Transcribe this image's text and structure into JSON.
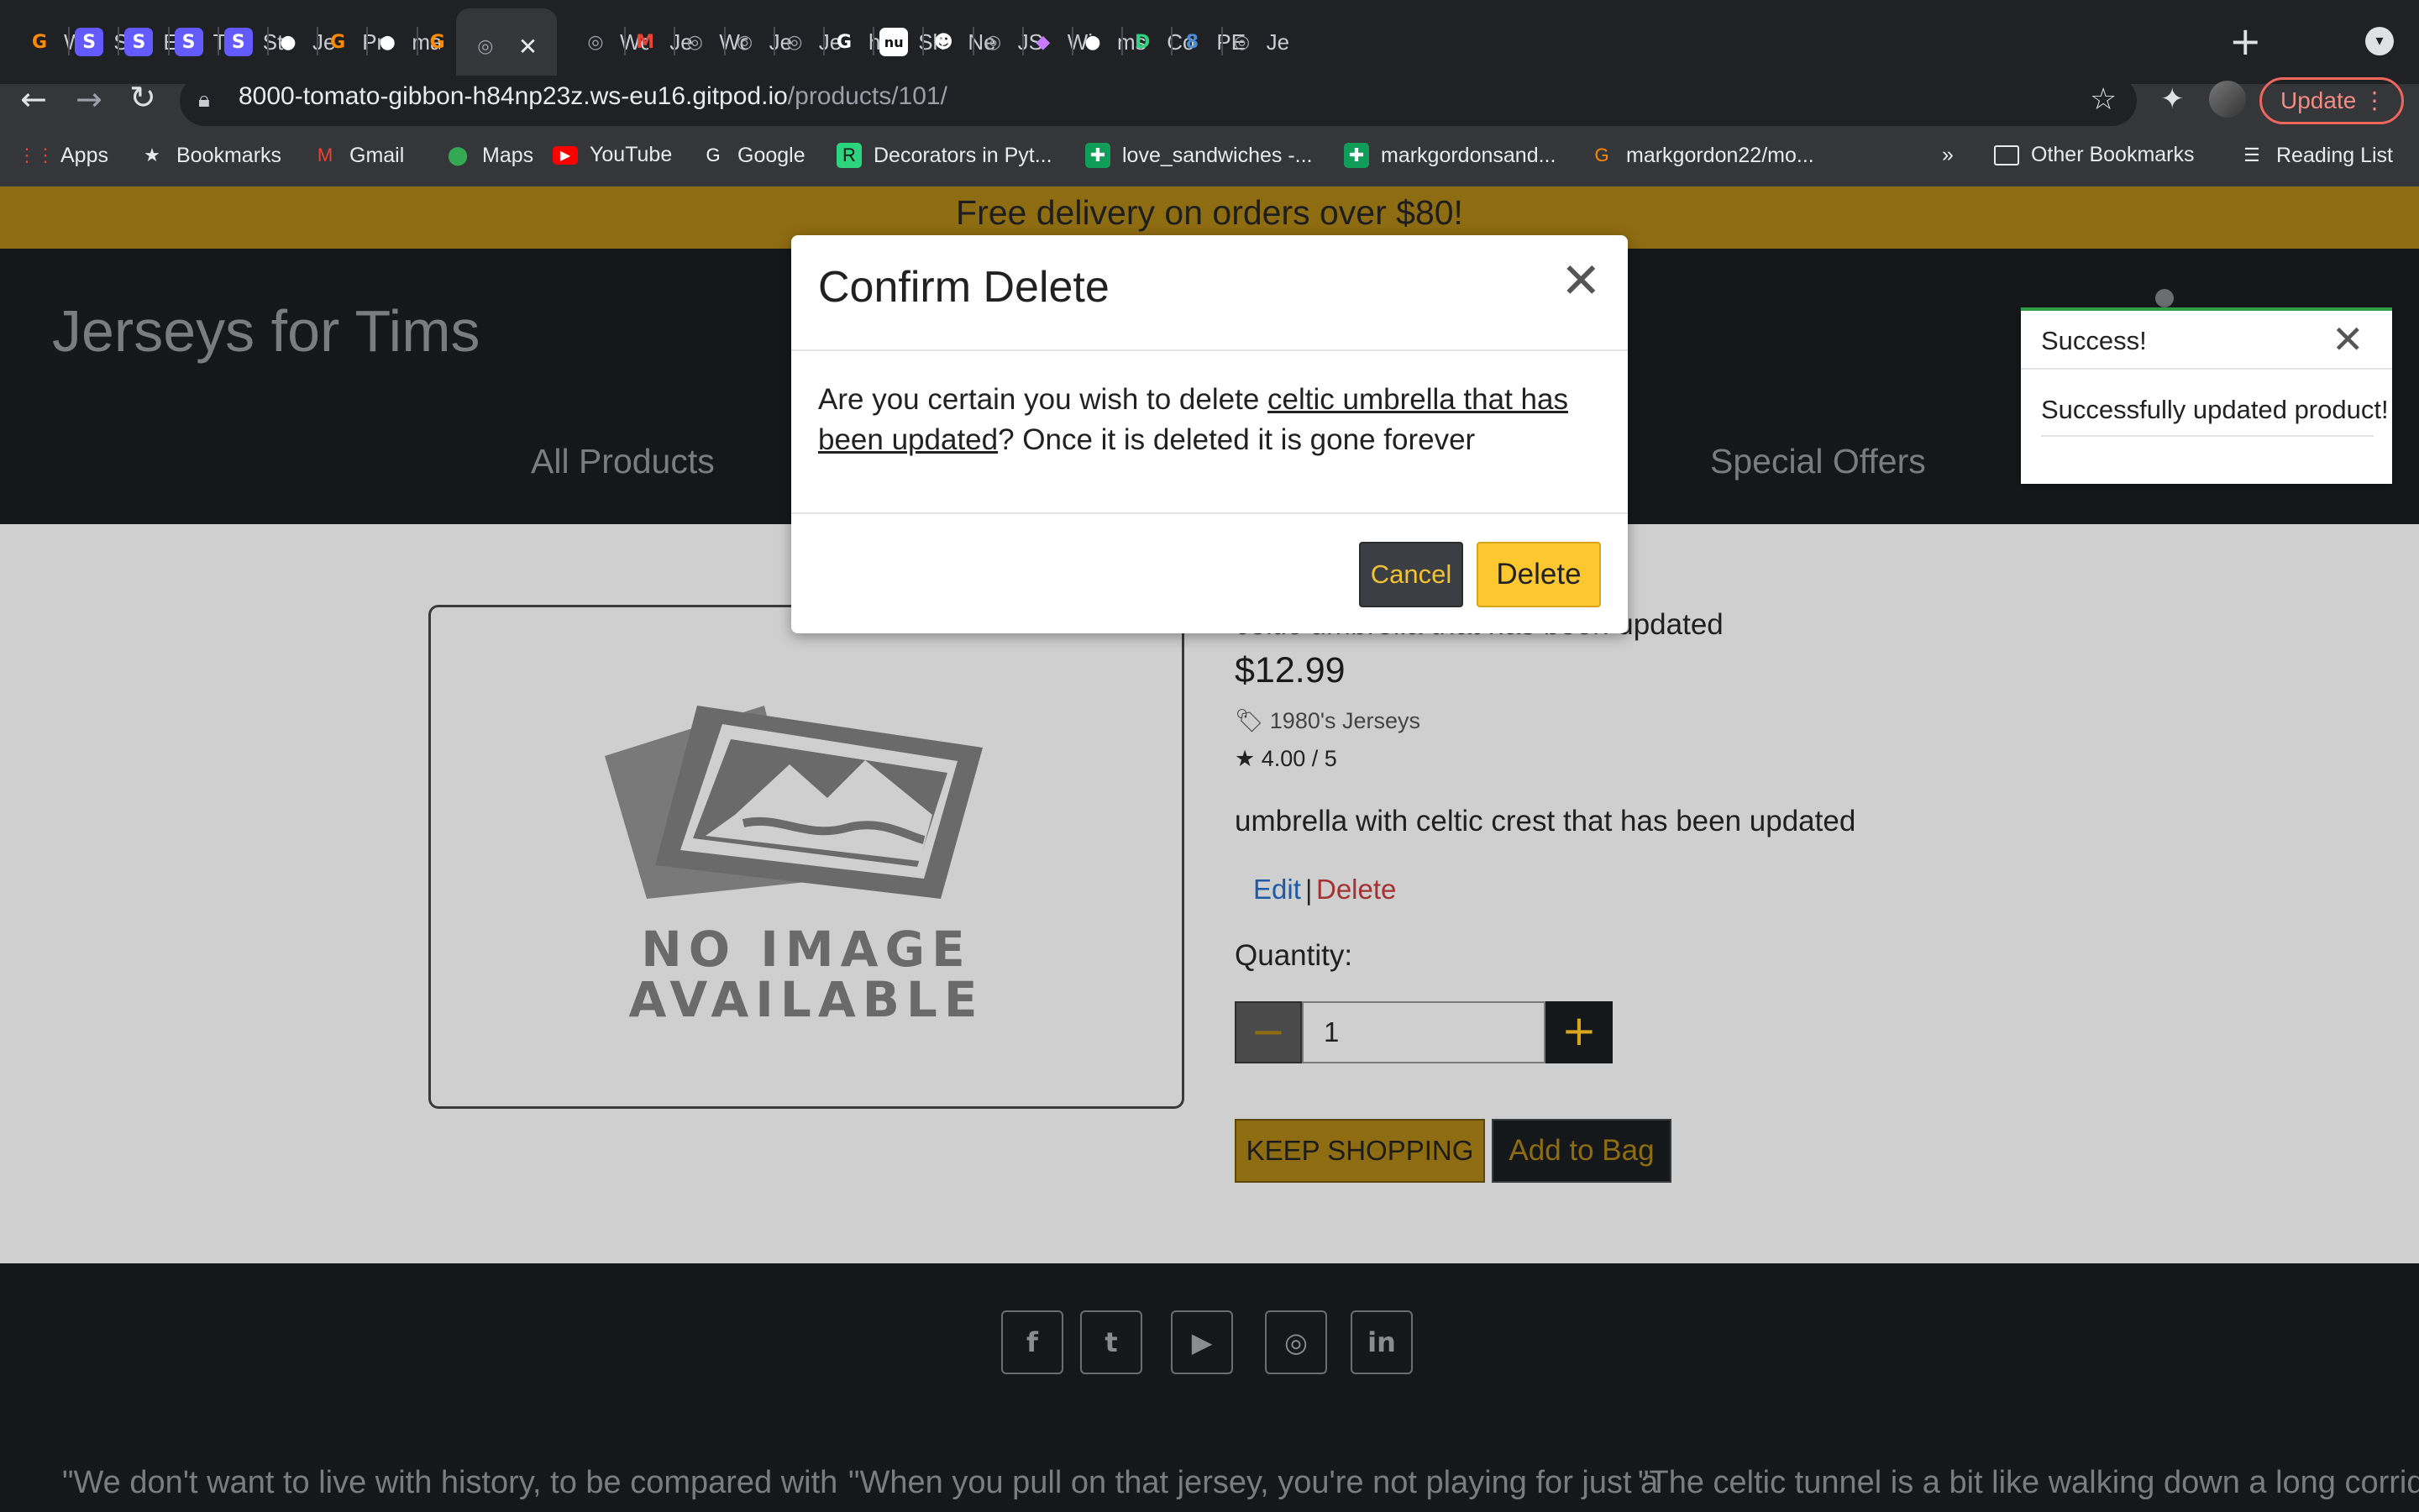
{
  "browser": {
    "tabs": [
      {
        "title": "Wo",
        "icon": "gitpod-icon",
        "color": "#ff8a00",
        "glyph": "G"
      },
      {
        "title": "Sa",
        "icon": "stripe-icon",
        "color": "#635bff",
        "glyph": "S"
      },
      {
        "title": "Ev",
        "icon": "stripe-icon",
        "color": "#635bff",
        "glyph": "S"
      },
      {
        "title": "Tri",
        "icon": "stripe-icon",
        "color": "#635bff",
        "glyph": "S"
      },
      {
        "title": "Str",
        "icon": "stripe-icon",
        "color": "#635bff",
        "glyph": "S"
      },
      {
        "title": "Je",
        "icon": "github-icon",
        "color": "#ffffff",
        "glyph": "●"
      },
      {
        "title": "Pr",
        "icon": "gitpod-icon",
        "color": "#ff8a00",
        "glyph": "G"
      },
      {
        "title": "ma",
        "icon": "github-icon",
        "color": "#ffffff",
        "glyph": "●"
      },
      {
        "title": "",
        "icon": "gitpod-icon",
        "color": "#ff8a00",
        "glyph": "G"
      },
      {
        "title": "",
        "icon": "globe-icon",
        "color": "#9aa0a6",
        "glyph": "◎"
      },
      {
        "title": "Wo",
        "icon": "globe-icon",
        "color": "#9aa0a6",
        "glyph": "◎"
      },
      {
        "title": "Je",
        "icon": "gmail-icon",
        "color": "#ea4335",
        "glyph": "M"
      },
      {
        "title": "Wo",
        "icon": "globe-icon",
        "color": "#9aa0a6",
        "glyph": "◎"
      },
      {
        "title": "Je",
        "icon": "globe-icon",
        "color": "#9aa0a6",
        "glyph": "◎"
      },
      {
        "title": "Je",
        "icon": "globe-icon",
        "color": "#9aa0a6",
        "glyph": "◎"
      },
      {
        "title": "htt",
        "icon": "google-icon",
        "color": "#ffffff",
        "glyph": "G"
      },
      {
        "title": "Sh",
        "icon": "nu-icon",
        "color": "#111111",
        "glyph": "nu"
      },
      {
        "title": "Ne",
        "icon": "emoji-icon",
        "color": "#ffffff",
        "glyph": "☻"
      },
      {
        "title": "JS",
        "icon": "globe-icon",
        "color": "#9aa0a6",
        "glyph": "◎"
      },
      {
        "title": "Wi",
        "icon": "colorful-icon",
        "color": "#c97bff",
        "glyph": "◆"
      },
      {
        "title": "ms",
        "icon": "github-icon",
        "color": "#ffffff",
        "glyph": "●"
      },
      {
        "title": "Co",
        "icon": "codeanywhere-icon",
        "color": "#2bd47d",
        "glyph": "D"
      },
      {
        "title": "PE",
        "icon": "pep8-icon",
        "color": "#4c8bd6",
        "glyph": "8"
      },
      {
        "title": "Je",
        "icon": "globe-icon",
        "color": "#9aa0a6",
        "glyph": "◎"
      }
    ],
    "url_host": "8000-tomato-gibbon-h84np23z.ws-eu16.gitpod.io",
    "url_path": "/products/101/",
    "update_label": "Update",
    "bookmarks": [
      {
        "label": "Apps",
        "icon": "apps-grid-icon",
        "color": "#ea4335",
        "glyph": "⋮⋮"
      },
      {
        "label": "Bookmarks",
        "icon": "star-icon",
        "color": "#e8eaed",
        "glyph": "★"
      },
      {
        "label": "Gmail",
        "icon": "gmail-icon",
        "color": "#ea4335",
        "glyph": "M"
      },
      {
        "label": "Maps",
        "icon": "maps-pin-icon",
        "color": "#34a853",
        "glyph": "⬤"
      },
      {
        "label": "YouTube",
        "icon": "youtube-icon",
        "color": "#ff0000",
        "glyph": "▶"
      },
      {
        "label": "Google",
        "icon": "google-icon",
        "color": "#ffffff",
        "glyph": "G"
      },
      {
        "label": "Decorators in Pyt...",
        "icon": "realpython-icon",
        "color": "#2bd47d",
        "glyph": "R"
      },
      {
        "label": "love_sandwiches -...",
        "icon": "sheets-icon",
        "color": "#0f9d58",
        "glyph": "✚"
      },
      {
        "label": "markgordonsand...",
        "icon": "sheets-icon",
        "color": "#0f9d58",
        "glyph": "✚"
      },
      {
        "label": "markgordon22/mo...",
        "icon": "gitpod-icon",
        "color": "#ff8a00",
        "glyph": "G"
      }
    ],
    "bookmarks_overflow": "»",
    "other_bookmarks": "Other Bookmarks",
    "reading_list": "Reading List"
  },
  "site": {
    "promo": "Free delivery on orders over $80!",
    "brand": "Jerseys for Tims",
    "nav": {
      "all_products": "All Products",
      "special_offers": "Special Offers"
    }
  },
  "product": {
    "name": "celtic umbrella that has been updated",
    "price": "$12.99",
    "category": "1980's Jerseys",
    "rating": "4.00 / 5",
    "description": "umbrella with celtic crest that has been updated",
    "edit": "Edit",
    "separator": "|",
    "delete": "Delete",
    "quantity_label": "Quantity:",
    "quantity": "1",
    "minus": "−",
    "plus": "+",
    "keep_shopping": "KEEP SHOPPING",
    "add_to_bag": "Add to Bag",
    "no_image_line1": "NO IMAGE",
    "no_image_line2": "AVAILABLE"
  },
  "footer": {
    "social": [
      {
        "name": "facebook",
        "glyph": "f"
      },
      {
        "name": "twitter",
        "glyph": "t"
      },
      {
        "name": "youtube",
        "glyph": "▶"
      },
      {
        "name": "instagram",
        "glyph": "◎"
      },
      {
        "name": "linkedin",
        "glyph": "in"
      }
    ],
    "quotes": [
      "\"We don't want to live with history, to be compared with",
      "\"When you pull on that jersey, you're not playing for just a",
      "\"The celtic tunnel is a bit like walking down a long corridor,"
    ]
  },
  "toast": {
    "title": "Success!",
    "message": "Successfully updated product!",
    "accent": "#2f9e44"
  },
  "modal": {
    "title": "Confirm Delete",
    "body_prefix": "Are you certain you wish to delete ",
    "body_product_line1": "celtic umbrella that has",
    "body_product_line2": "been updated",
    "body_suffix": "? Once it is deleted it is gone forever",
    "cancel": "Cancel",
    "delete": "Delete"
  },
  "colors": {
    "accent_gold": "#8e6c12",
    "button_yellow": "#fcc72f",
    "dark": "#15181b",
    "edit_blue": "#1d5aa8",
    "delete_red": "#a33232"
  }
}
